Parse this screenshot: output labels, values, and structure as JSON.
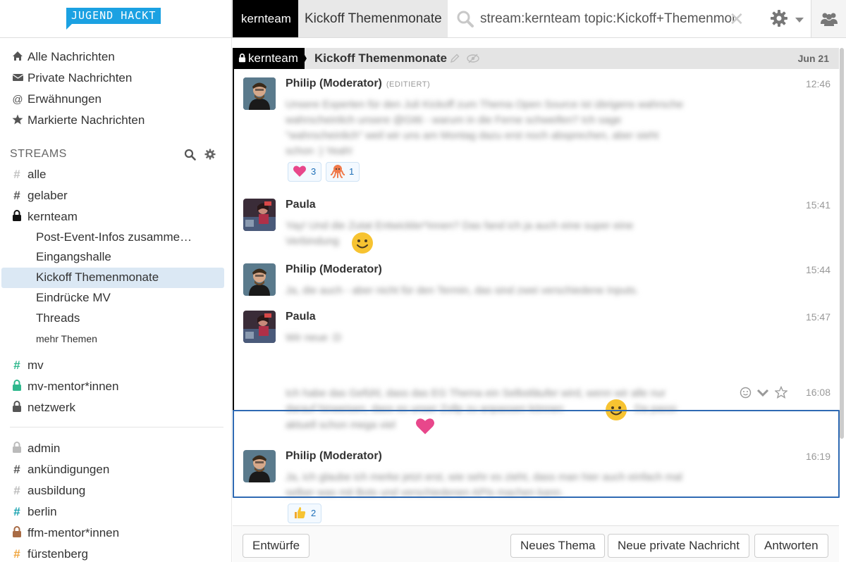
{
  "header": {
    "logo_text": "JUGEND HACKT",
    "stream_tab": "kernteam",
    "topic_tab": "Kickoff Themenmonate",
    "search_value": "stream:kernteam topic:Kickoff+Themenmonate",
    "icons": [
      "search-icon",
      "close-icon",
      "gear-icon",
      "chevron-down-icon",
      "users-icon"
    ]
  },
  "sidebar": {
    "nav": [
      {
        "label": "Alle Nachrichten",
        "icon": "home-icon"
      },
      {
        "label": "Private Nachrichten",
        "icon": "envelope-icon"
      },
      {
        "label": "Erwähnungen",
        "icon": "at-icon"
      },
      {
        "label": "Markierte Nachrichten",
        "icon": "star-icon"
      }
    ],
    "streams_label": "STREAMS",
    "streams": [
      {
        "name": "alle",
        "type": "hash",
        "color": "#c2c2c2"
      },
      {
        "name": "gelaber",
        "type": "hash",
        "color": "#555555"
      },
      {
        "name": "kernteam",
        "type": "lock",
        "color": "#111111"
      }
    ],
    "topics": [
      {
        "label": "Post-Event-Infos zusamme…"
      },
      {
        "label": "Eingangshalle"
      },
      {
        "label": "Kickoff Themenmonate",
        "active": true
      },
      {
        "label": "Eindrücke MV"
      },
      {
        "label": "Threads"
      }
    ],
    "more_topics": "mehr Themen",
    "streams_after": [
      {
        "name": "mv",
        "type": "hash",
        "color": "#2fb88d"
      },
      {
        "name": "mv-mentor*innen",
        "type": "lock",
        "color": "#2fb88d"
      },
      {
        "name": "netzwerk",
        "type": "lock",
        "color": "#555555"
      }
    ],
    "inactive_streams": [
      {
        "name": "admin",
        "type": "lock",
        "color": "#bbbbbb"
      },
      {
        "name": "ankündigungen",
        "type": "hash",
        "color": "#555555"
      },
      {
        "name": "ausbildung",
        "type": "hash",
        "color": "#bbbbbb"
      },
      {
        "name": "berlin",
        "type": "hash",
        "color": "#1aa3b0"
      },
      {
        "name": "ffm-mentor*innen",
        "type": "lock",
        "color": "#a86b45"
      },
      {
        "name": "fürstenberg",
        "type": "hash",
        "color": "#f0a640"
      }
    ]
  },
  "recipient_bar": {
    "stream": "kernteam",
    "topic": "Kickoff Themenmonate",
    "date": "Jun 21"
  },
  "messages": [
    {
      "sender": "Philip (Moderator)",
      "edited": "(EDITIERT)",
      "time": "12:46",
      "reactions": [
        {
          "emoji": "heart",
          "count": "3"
        },
        {
          "emoji": "octopus",
          "count": "1"
        }
      ]
    },
    {
      "sender": "Paula",
      "time": "15:41"
    },
    {
      "sender": "Philip (Moderator)",
      "time": "15:44"
    },
    {
      "sender": "Paula",
      "time": "15:47"
    },
    {
      "time": "16:08"
    },
    {
      "sender": "Philip (Moderator)",
      "time": "16:19",
      "reactions": [
        {
          "emoji": "thumbs-up",
          "count": "2"
        }
      ]
    }
  ],
  "compose": {
    "drafts": "Entwürfe",
    "new_topic": "Neues Thema",
    "new_private": "Neue private Nachricht",
    "reply": "Antworten"
  }
}
